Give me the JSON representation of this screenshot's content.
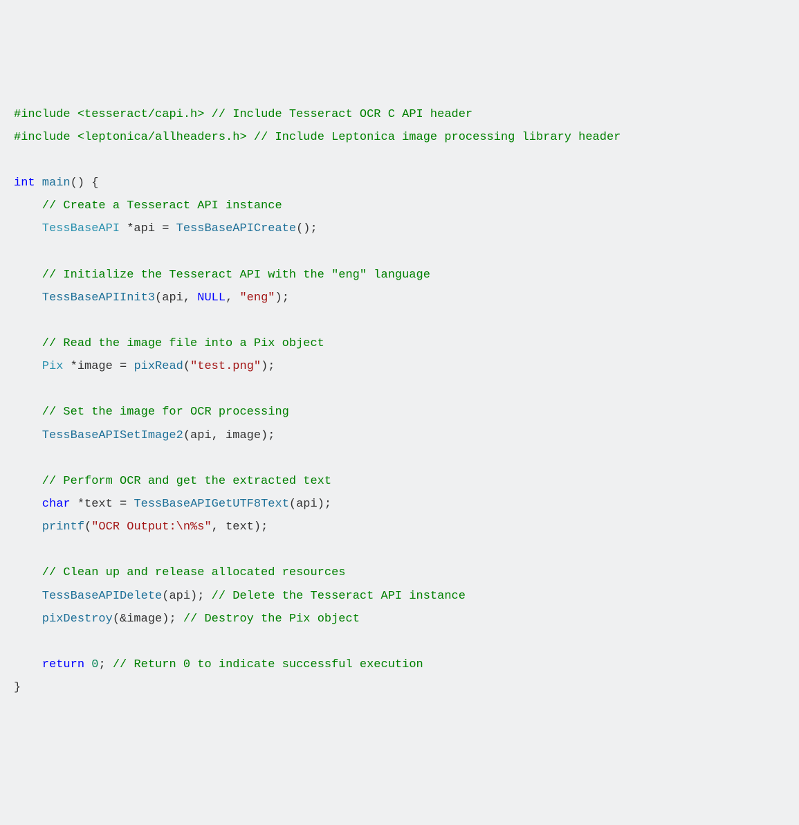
{
  "code": {
    "l1_inc": "#include",
    "l1_hdr": " <tesseract/capi.h> ",
    "l1_com": "// Include Tesseract OCR C API header",
    "l2_inc": "#include",
    "l2_hdr": " <leptonica/allheaders.h> ",
    "l2_com": "// Include Leptonica image processing library header",
    "l4_kw_int": "int",
    "l4_main": " main",
    "l4_paren": "() {",
    "l5_com": "    // Create a Tesseract API instance",
    "l6_ty": "    TessBaseAPI",
    "l6_var": " *api = ",
    "l6_fn": "TessBaseAPICreate",
    "l6_end": "();",
    "l8_com": "    // Initialize the Tesseract API with the \"eng\" language",
    "l9_fn": "    TessBaseAPIInit3",
    "l9_open": "(api, ",
    "l9_null": "NULL",
    "l9_mid": ", ",
    "l9_str": "\"eng\"",
    "l9_end": ");",
    "l11_com": "    // Read the image file into a Pix object",
    "l12_ty": "    Pix",
    "l12_var": " *image = ",
    "l12_fn": "pixRead",
    "l12_open": "(",
    "l12_str": "\"test.png\"",
    "l12_end": ");",
    "l14_com": "    // Set the image for OCR processing",
    "l15_fn": "    TessBaseAPISetImage2",
    "l15_args": "(api, image);",
    "l17_com": "    // Perform OCR and get the extracted text",
    "l18_kw": "    char",
    "l18_var": " *text = ",
    "l18_fn": "TessBaseAPIGetUTF8Text",
    "l18_args": "(api);",
    "l19_fn": "    printf",
    "l19_open": "(",
    "l19_str": "\"OCR Output:\\n%s\"",
    "l19_rest": ", text);",
    "l21_com": "    // Clean up and release allocated resources",
    "l22_fn": "    TessBaseAPIDelete",
    "l22_args": "(api); ",
    "l22_com": "// Delete the Tesseract API instance",
    "l23_fn": "    pixDestroy",
    "l23_args": "(&image); ",
    "l23_com": "// Destroy the Pix object",
    "l25_kw": "    return",
    "l25_sp": " ",
    "l25_num": "0",
    "l25_semi": "; ",
    "l25_com": "// Return 0 to indicate successful execution",
    "l26": "}"
  }
}
